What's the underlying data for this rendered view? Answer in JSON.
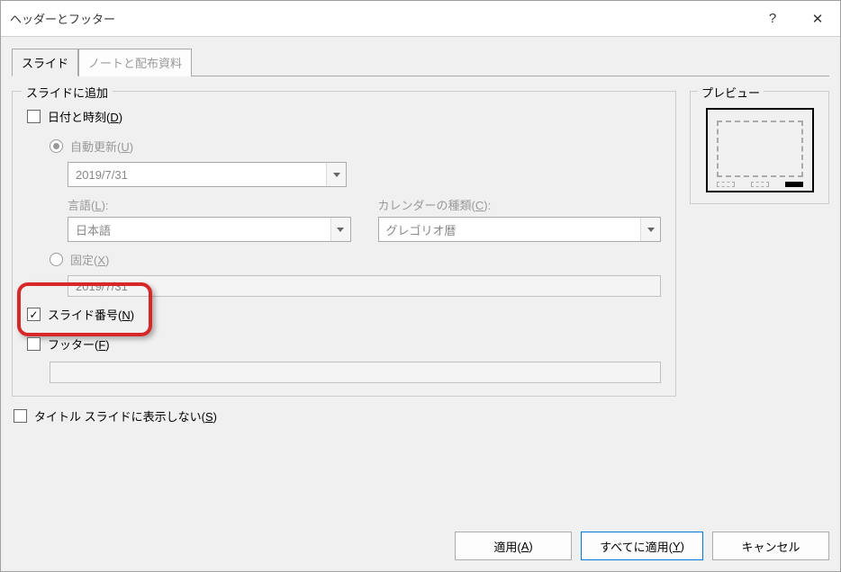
{
  "titlebar": {
    "title": "ヘッダーとフッター",
    "help": "?",
    "close": "✕"
  },
  "tabs": {
    "slide": "スライド",
    "notes": "ノートと配布資料"
  },
  "groupLegend": "スライドに追加",
  "dateTime": {
    "label": "日付と時刻(",
    "accel": "D",
    "label2": ")"
  },
  "autoUpdate": {
    "label": "自動更新(",
    "accel": "U",
    "label2": ")"
  },
  "dateDropdown": "2019/7/31",
  "language": {
    "label": "言語(",
    "accel": "L",
    "label2": "):",
    "value": "日本語"
  },
  "calendar": {
    "label": "カレンダーの種類(",
    "accel": "C",
    "label2": "):",
    "value": "グレゴリオ暦"
  },
  "fixed": {
    "label": "固定(",
    "accel": "X",
    "label2": ")",
    "value": "2019/7/31"
  },
  "slideNumber": {
    "label": "スライド番号(",
    "accel": "N",
    "label2": ")"
  },
  "footer": {
    "label": "フッター(",
    "accel": "F",
    "label2": ")"
  },
  "dontShowTitle": {
    "label": "タイトル スライドに表示しない(",
    "accel": "S",
    "label2": ")"
  },
  "preview": {
    "legend": "プレビュー"
  },
  "buttons": {
    "apply": "適用(",
    "applyAccel": "A",
    "apply2": ")",
    "applyAll": "すべてに適用(",
    "applyAllAccel": "Y",
    "applyAll2": ")",
    "cancel": "キャンセル"
  }
}
